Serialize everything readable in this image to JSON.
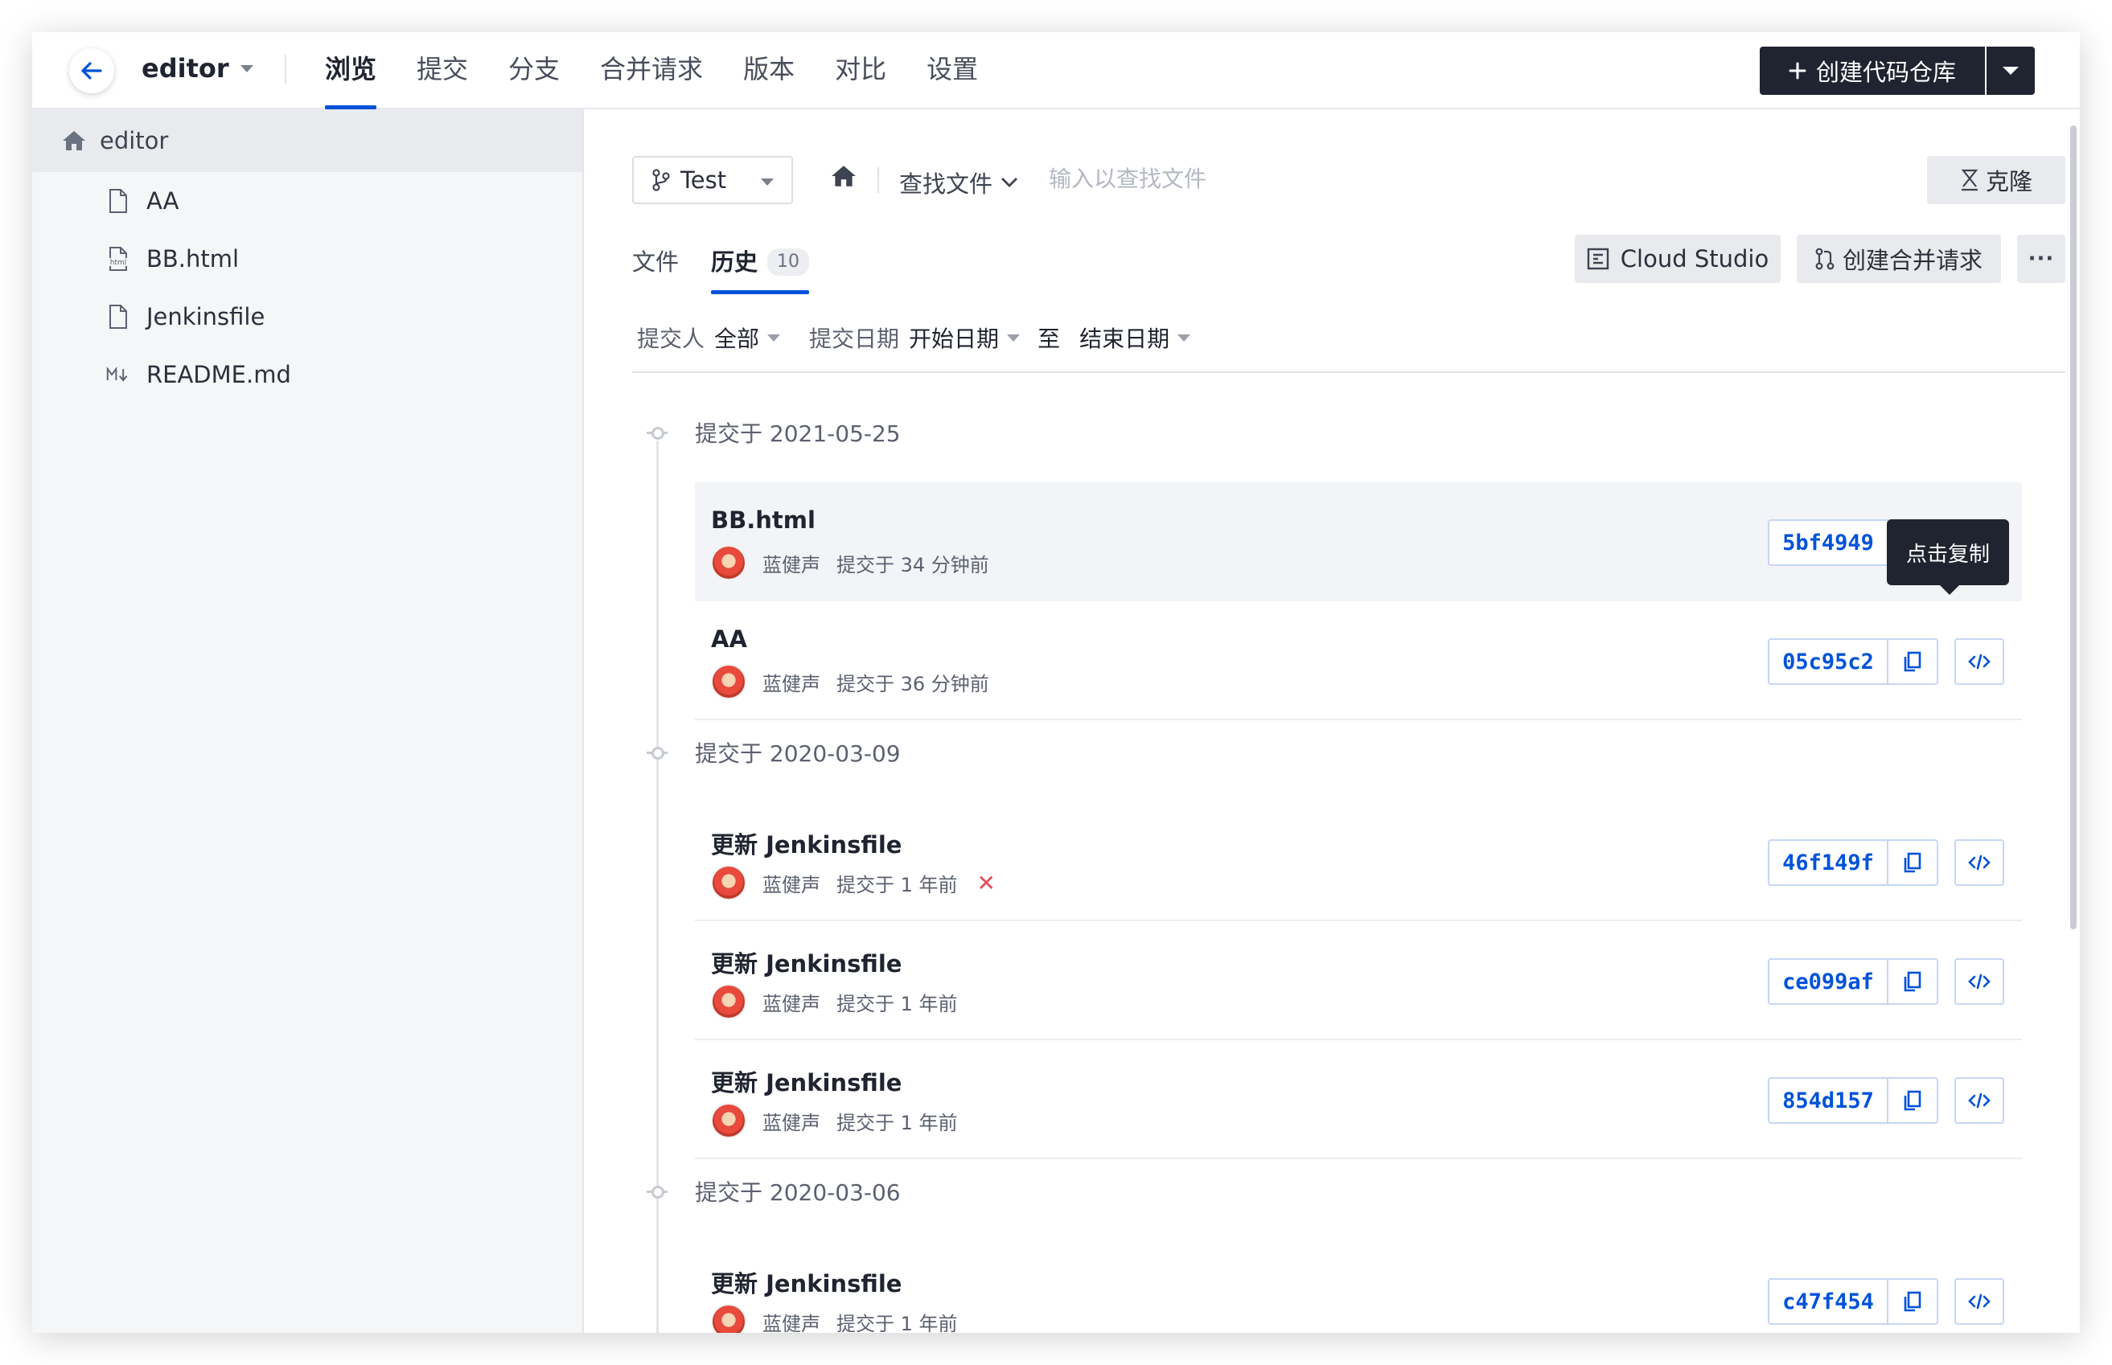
{
  "header": {
    "repo_name": "editor",
    "nav_tabs": [
      "浏览",
      "提交",
      "分支",
      "合并请求",
      "版本",
      "对比",
      "设置"
    ],
    "active_tab": 0,
    "create_button": "创建代码仓库"
  },
  "sidebar": {
    "root": "editor",
    "files": [
      {
        "name": "AA",
        "icon": "file-icon"
      },
      {
        "name": "BB.html",
        "icon": "html-file-icon"
      },
      {
        "name": "Jenkinsfile",
        "icon": "file-icon"
      },
      {
        "name": "README.md",
        "icon": "markdown-icon"
      }
    ]
  },
  "toolbar": {
    "branch": "Test",
    "find_file": "查找文件",
    "find_placeholder": "输入以查找文件",
    "clone": "克隆"
  },
  "subtabs": {
    "files": "文件",
    "history": "历史",
    "history_count": "10"
  },
  "actions": {
    "cloud_studio": "Cloud Studio",
    "create_mr": "创建合并请求",
    "more": "···"
  },
  "filters": {
    "committer_label": "提交人",
    "committer_value": "全部",
    "date_label": "提交日期",
    "start_date": "开始日期",
    "to": "至",
    "end_date": "结束日期"
  },
  "tooltip": "点击复制",
  "groups": [
    {
      "date": "提交于 2021-05-25",
      "commits": [
        {
          "title": "BB.html",
          "author": "蓝健声",
          "when": "提交于 34 分钟前",
          "hash": "5bf4949",
          "failed": false
        },
        {
          "title": "AA",
          "author": "蓝健声",
          "when": "提交于 36 分钟前",
          "hash": "05c95c2",
          "failed": false
        }
      ]
    },
    {
      "date": "提交于 2020-03-09",
      "commits": [
        {
          "title": "更新 Jenkinsfile",
          "author": "蓝健声",
          "when": "提交于 1 年前",
          "hash": "46f149f",
          "failed": true
        },
        {
          "title": "更新 Jenkinsfile",
          "author": "蓝健声",
          "when": "提交于 1 年前",
          "hash": "ce099af",
          "failed": false
        },
        {
          "title": "更新 Jenkinsfile",
          "author": "蓝健声",
          "when": "提交于 1 年前",
          "hash": "854d157",
          "failed": false
        }
      ]
    },
    {
      "date": "提交于 2020-03-06",
      "commits": [
        {
          "title": "更新 Jenkinsfile",
          "author": "蓝健声",
          "when": "提交于 1 年前",
          "hash": "c47f454",
          "failed": false
        }
      ]
    }
  ],
  "colors": {
    "accent": "#0052d9",
    "dark": "#1f2430",
    "error": "#e34d59"
  }
}
